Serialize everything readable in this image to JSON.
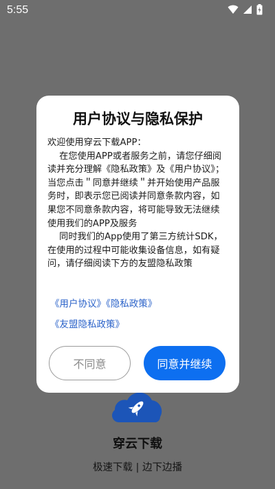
{
  "status_bar": {
    "time": "5:55"
  },
  "dialog": {
    "title": "用户协议与隐私保护",
    "greeting": "欢迎使用穿云下载APP：",
    "paragraph_1": "在您使用APP或者服务之前，请您仔细阅读并充分理解《隐私政策》及《用户协议》；当您点击＂同意并继续＂并开始使用产品服务时，即表示您已阅读并同意条款内容，如果您不同意条款内容，将可能导致无法继续使用我们的APP及服务",
    "paragraph_2": "同时我们的App使用了第三方统计SDK，在使用的过程中可能收集设备信息，如有疑问，请仔细阅读下方的友盟隐私政策",
    "links": {
      "user_agreement": "《用户协议》",
      "privacy_policy": "《隐私政策》",
      "umeng_privacy": "《友盟隐私政策》"
    },
    "buttons": {
      "disagree": "不同意",
      "agree": "同意并继续"
    }
  },
  "app": {
    "name": "穿云下载",
    "slogan": "极速下载 | 边下边播"
  },
  "colors": {
    "accent": "#0d6ff0",
    "link": "#2a62c9",
    "overlay": "#6e6e6e"
  },
  "icons": [
    "wifi-icon",
    "signal-icon",
    "battery-icon",
    "rocket-cloud-logo-icon"
  ]
}
